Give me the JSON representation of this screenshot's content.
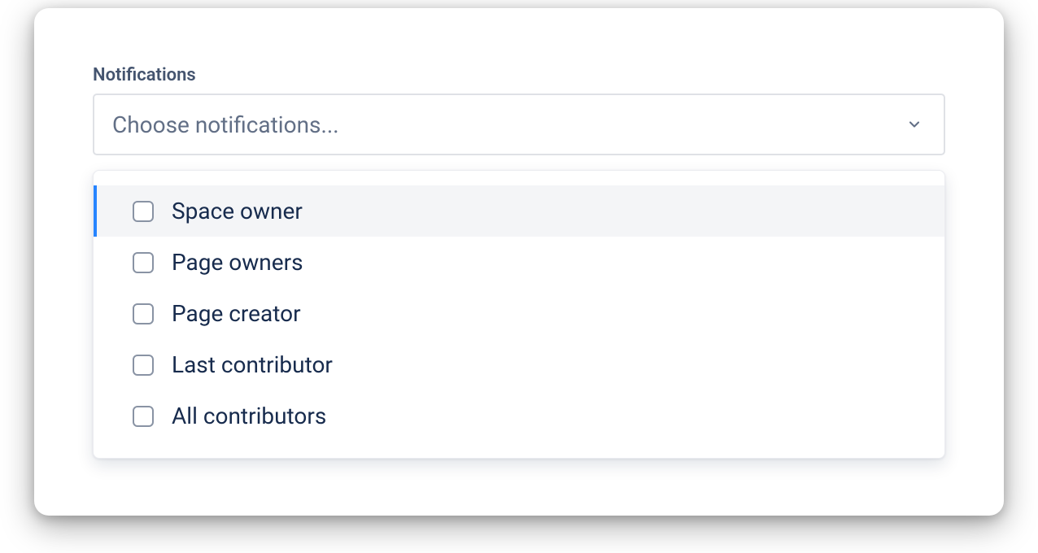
{
  "field": {
    "label": "Notifications",
    "placeholder": "Choose notifications..."
  },
  "options": [
    {
      "label": "Space owner",
      "highlighted": true
    },
    {
      "label": "Page owners",
      "highlighted": false
    },
    {
      "label": "Page creator",
      "highlighted": false
    },
    {
      "label": "Last contributor",
      "highlighted": false
    },
    {
      "label": "All contributors",
      "highlighted": false
    }
  ]
}
